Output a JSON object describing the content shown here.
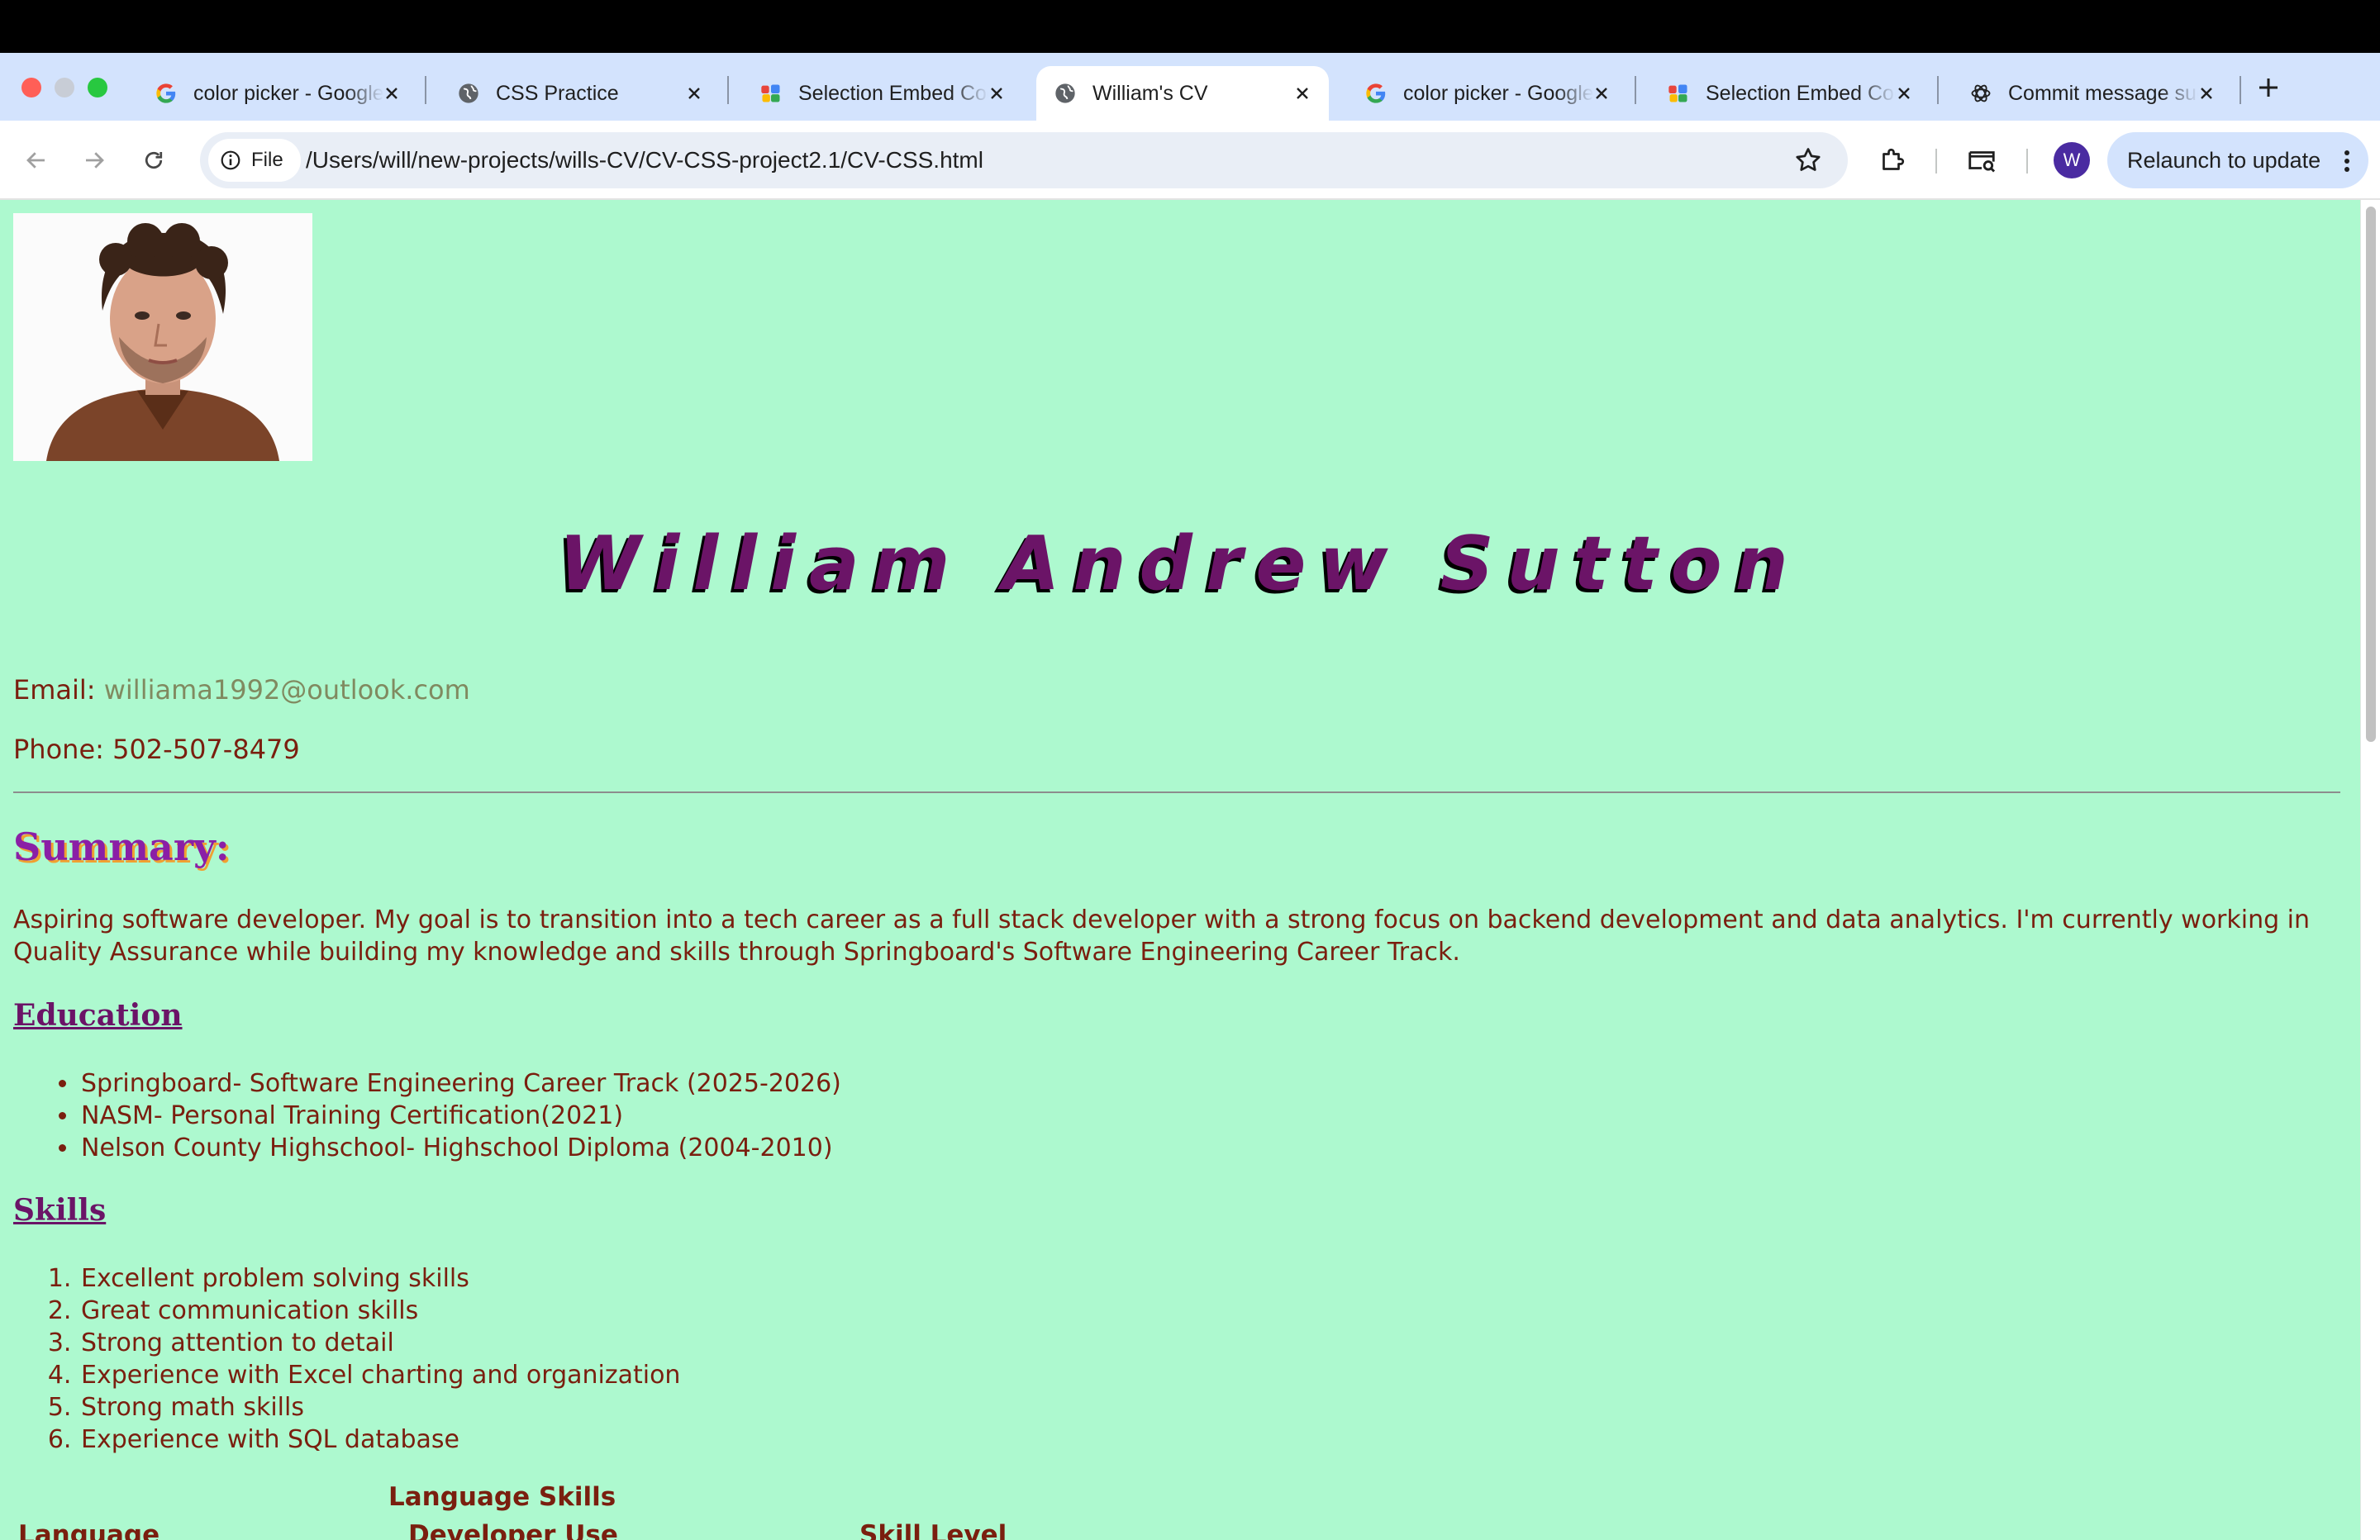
{
  "browser": {
    "tabs": [
      {
        "title": "color picker - Google Search",
        "favicon": "google-g-icon",
        "active": false
      },
      {
        "title": "CSS Practice",
        "favicon": "globe-icon",
        "active": false
      },
      {
        "title": "Selection Embed Code",
        "favicon": "embed-app-icon",
        "active": false
      },
      {
        "title": "William's CV",
        "favicon": "globe-icon",
        "active": true
      },
      {
        "title": "color picker - Google Search",
        "favicon": "google-g-icon",
        "active": false
      },
      {
        "title": "Selection Embed Code",
        "favicon": "embed-app-icon",
        "active": false
      },
      {
        "title": "Commit message suggestions",
        "favicon": "chatgpt-icon",
        "active": false
      }
    ],
    "site_info_label": "File",
    "url": "/Users/will/new-projects/wills-CV/CV-CSS-project2.1/CV-CSS.html",
    "avatar_letter": "W",
    "relaunch_label": "Relaunch to update"
  },
  "cv": {
    "name": "William Andrew Sutton",
    "email_label": "Email:",
    "email": "williama1992@outlook.com",
    "phone_label": "Phone:",
    "phone": "502-507-8479",
    "summary_heading": "Summary:",
    "summary_text": "Aspiring software developer. My goal is to transition into a tech career as a full stack developer with a strong focus on backend development and data analytics. I'm currently working in Quality Assurance while building my knowledge and skills through Springboard's Software Engineering Career Track.",
    "education_heading": "Education",
    "education": [
      "Springboard- Software Engineering Career Track (2025-2026)",
      "NASM- Personal Training Certification(2021)",
      "Nelson County Highschool- Highschool Diploma (2004-2010)"
    ],
    "skills_heading": "Skills",
    "skills": [
      "Excellent problem solving skills",
      "Great communication skills",
      "Strong attention to detail",
      "Experience with Excel charting and organization",
      "Strong math skills",
      "Experience with SQL database"
    ],
    "language_table": {
      "caption": "Language Skills",
      "headers": [
        "Language",
        "Developer Use",
        "Skill Level"
      ]
    }
  }
}
